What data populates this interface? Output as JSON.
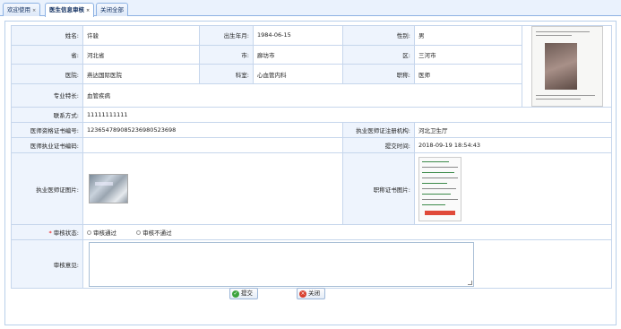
{
  "tabs": [
    {
      "label": "欢迎使用",
      "active": false,
      "closable": true
    },
    {
      "label": "医生信息审核",
      "active": true,
      "closable": true
    },
    {
      "label": "关闭全部",
      "active": false,
      "closable": false
    }
  ],
  "close_glyph": "×",
  "form": {
    "name_label": "姓名:",
    "name": "许骏",
    "birth_label": "出生年月:",
    "birth": "1984-06-15",
    "gender_label": "性别:",
    "gender": "男",
    "province_label": "省:",
    "province": "河北省",
    "city_label": "市:",
    "city": "廊坊市",
    "district_label": "区:",
    "district": "三河市",
    "hospital_label": "医院:",
    "hospital": "燕达国际医院",
    "dept_label": "科室:",
    "dept": "心血管内科",
    "title_label": "职称:",
    "title": "医师",
    "specialty_label": "专业特长:",
    "specialty": "血管疾病",
    "phone_label": "联系方式:",
    "phone": "11111111111",
    "qual_cert_label": "医师资格证书编号:",
    "qual_cert": "123654789085236980523698",
    "reg_org_label": "执业医师证注册机构:",
    "reg_org": "河北卫生厅",
    "practice_cert_label": "医师执业证书编码:",
    "practice_cert": "",
    "submit_time_label": "提交时间:",
    "submit_time": "2018-09-19 18:54:43",
    "practice_img_label": "执业医师证图片:",
    "title_img_label": "职称证书图片:",
    "review_status_label": "审核状态:",
    "required_mark": "*",
    "review_pass": "审核通过",
    "review_fail": "审核不通过",
    "review_opinion_label": "审核意见:",
    "review_opinion": ""
  },
  "buttons": {
    "submit": "提交",
    "close": "关闭"
  },
  "icons": {
    "submit": "check-circle-icon",
    "close": "close-circle-icon"
  }
}
